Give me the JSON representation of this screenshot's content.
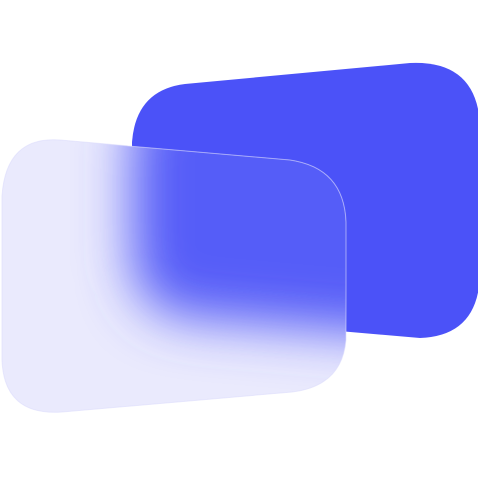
{
  "icon": {
    "name": "stacked-cards-icon",
    "colors": {
      "accent": "#4B52F8",
      "frost": "#E9E9FD",
      "background": "#FFFFFF"
    }
  }
}
